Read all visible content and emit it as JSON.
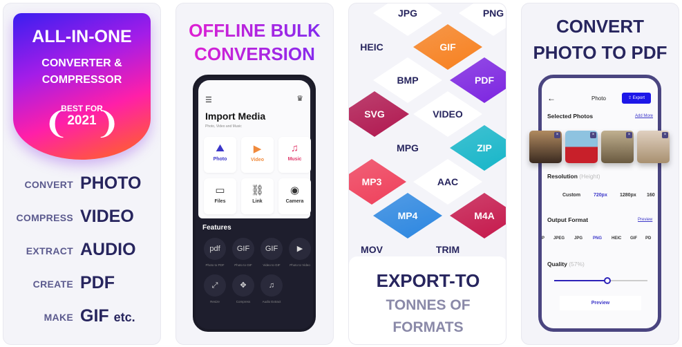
{
  "panel1": {
    "badge": {
      "title": "ALL-IN-ONE",
      "line1": "CONVERTER &",
      "line2": "COMPRESSOR",
      "award_top": "BEST FOR",
      "award_year": "2021"
    },
    "rows": [
      {
        "small": "CONVERT",
        "big": "PHOTO"
      },
      {
        "small": "COMPRESS",
        "big": "VIDEO"
      },
      {
        "small": "EXTRACT",
        "big": "AUDIO"
      },
      {
        "small": "CREATE",
        "big": "PDF"
      },
      {
        "small": "MAKE",
        "big": "GIF",
        "suffix": "etc."
      }
    ]
  },
  "panel2": {
    "title1": "OFFLINE BULK",
    "title2": "CONVERSION",
    "screen": {
      "heading": "Import Media",
      "subtitle": "Photo, Video and Music",
      "tiles": [
        {
          "label": "Photo",
          "icon": "image-icon",
          "color": "#3b36c9"
        },
        {
          "label": "Video",
          "icon": "video-icon",
          "color": "#f08a3c"
        },
        {
          "label": "Music",
          "icon": "music-icon",
          "color": "#e0386a"
        },
        {
          "label": "Files",
          "icon": "folder-icon",
          "color": "#333333"
        },
        {
          "label": "Link",
          "icon": "link-icon",
          "color": "#333333"
        },
        {
          "label": "Camera",
          "icon": "camera-icon",
          "color": "#333333"
        }
      ],
      "features_title": "Features",
      "features": [
        {
          "label": "Photo to PDF",
          "glyph": "pdf"
        },
        {
          "label": "Photo to GIF",
          "glyph": "GIF"
        },
        {
          "label": "Video to GIF",
          "glyph": "GIF"
        },
        {
          "label": "Photo to Video",
          "glyph": "▶"
        },
        {
          "label": "Resize",
          "glyph": "⤢"
        },
        {
          "label": "Compress",
          "glyph": "✥"
        },
        {
          "label": "Audio Extract",
          "glyph": "♫"
        }
      ]
    }
  },
  "panel3": {
    "formats": [
      {
        "label": "JPG",
        "color": "#ffffff"
      },
      {
        "label": "PNG",
        "color": "#ffffff"
      },
      {
        "label": "HEIC",
        "color": "none"
      },
      {
        "label": "GIF",
        "color": "#f7801e"
      },
      {
        "label": "BMP",
        "color": "#ffffff"
      },
      {
        "label": "PDF",
        "color": "#7b22e0"
      },
      {
        "label": "SVG",
        "color": "#b0174f"
      },
      {
        "label": "VIDEO",
        "color": "#ffffff"
      },
      {
        "label": "MPG",
        "color": "none"
      },
      {
        "label": "ZIP",
        "color": "#14b5c8"
      },
      {
        "label": "MP3",
        "color": "#ef3f5a"
      },
      {
        "label": "AAC",
        "color": "#ffffff"
      },
      {
        "label": "MP4",
        "color": "#2b86e0"
      },
      {
        "label": "M4A",
        "color": "#c5164a"
      },
      {
        "label": "MOV",
        "color": "none"
      },
      {
        "label": "TRIM",
        "color": "none"
      }
    ],
    "caption1": "EXPORT-TO",
    "caption2": "TONNES OF",
    "caption3": "FORMATS"
  },
  "panel4": {
    "title1": "CONVERT",
    "title2": "PHOTO TO PDF",
    "screen": {
      "nav_title": "Photo",
      "export_label": "Export",
      "selected_label": "Selected Photos",
      "add_more": "Add More",
      "resolution_label": "Resolution",
      "resolution_hint": "(Height)",
      "resolutions": [
        "Custom",
        "720px",
        "1280px",
        "160"
      ],
      "resolution_selected": "720px",
      "output_label": "Output Format",
      "output_preview": "Preview",
      "formats": [
        "P",
        "JPEG",
        "JPG",
        "PNG",
        "HEIC",
        "GIF",
        "PD"
      ],
      "format_selected": "PNG",
      "quality_label": "Quality",
      "quality_value": "(57%)",
      "quality_percent": 57,
      "preview_button": "Preview"
    }
  },
  "colors": {
    "navy": "#27255e",
    "accent": "#3b36c9",
    "purple_border": "#4a4580"
  }
}
